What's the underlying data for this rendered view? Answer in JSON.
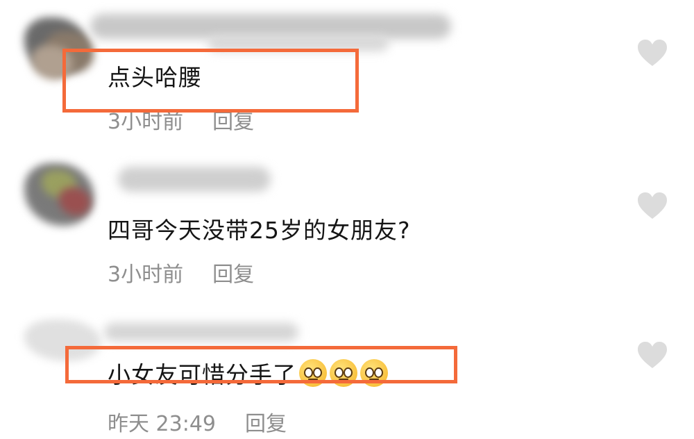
{
  "comments": [
    {
      "text": "点头哈腰",
      "time": "3小时前",
      "reply": "回复"
    },
    {
      "text": "四哥今天没带25岁的女朋友?",
      "time": "3小时前",
      "reply": "回复"
    },
    {
      "text": "小女友可惜分手了",
      "time": "昨天 23:49",
      "reply": "回复",
      "emojis": [
        "pleading-face-emoji",
        "crying-face-emoji",
        "crying-face-emoji"
      ]
    }
  ],
  "highlight_color": "#f46a3a",
  "heart_color": "#dcdcdc",
  "icons": {
    "like": "heart-icon"
  }
}
